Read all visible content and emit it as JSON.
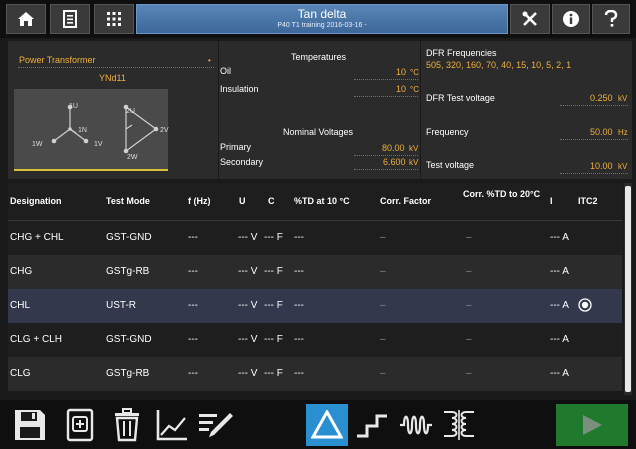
{
  "header": {
    "title": "Tan delta",
    "subtitle": "P40 T1 training 2016-03-16 -"
  },
  "asset": {
    "type": "Power Transformer",
    "vector_group": "YNd11",
    "hv_winding": "YN",
    "lv_winding": "d11",
    "diagram_labels": {
      "u1": "1U",
      "v1": "1V",
      "w1": "1W",
      "n1": "1N",
      "u2": "2U",
      "v2": "2V",
      "w2": "2W"
    }
  },
  "temperatures": {
    "heading": "Temperatures",
    "oil_label": "Oil",
    "oil_value": "10",
    "oil_unit": "°C",
    "insulation_label": "Insulation",
    "insulation_value": "10",
    "insulation_unit": "°C"
  },
  "nominal_voltages": {
    "heading": "Nominal Voltages",
    "primary_label": "Primary",
    "primary_value": "80.00",
    "primary_unit": "kV",
    "secondary_label": "Secondary",
    "secondary_value": "6.600",
    "secondary_unit": "kV"
  },
  "dfr": {
    "freq_heading": "DFR Frequencies",
    "freq_list": "505, 320, 160, 70, 40, 15, 10, 5, 2, 1",
    "test_voltage_label": "DFR Test voltage",
    "test_voltage_value": "0.250",
    "test_voltage_unit": "kV"
  },
  "frequency": {
    "label": "Frequency",
    "value": "50.00",
    "unit": "Hz"
  },
  "test_voltage": {
    "label": "Test voltage",
    "value": "10.00",
    "unit": "kV"
  },
  "table": {
    "headers": {
      "designation": "Designation",
      "test_mode": "Test Mode",
      "f": "f (Hz)",
      "u": "U",
      "c": "C",
      "td10": "%TD at 10 °C",
      "corr": "Corr. Factor",
      "corrtd": "Corr. %TD to 20°C",
      "i": "I",
      "itc2": "ITC2"
    },
    "rows": [
      {
        "designation": "CHG + CHL",
        "mode": "GST-GND",
        "f": "---",
        "u": "--- V",
        "c": "--- F",
        "td": "---",
        "corr": "–",
        "corrtd": "–",
        "i": "--- A"
      },
      {
        "designation": "CHG",
        "mode": "GSTg-RB",
        "f": "---",
        "u": "--- V",
        "c": "--- F",
        "td": "---",
        "corr": "–",
        "corrtd": "–",
        "i": "--- A"
      },
      {
        "designation": "CHL",
        "mode": "UST-R",
        "f": "---",
        "u": "--- V",
        "c": "--- F",
        "td": "---",
        "corr": "–",
        "corrtd": "–",
        "i": "--- A"
      },
      {
        "designation": "CLG + CLH",
        "mode": "GST-GND",
        "f": "---",
        "u": "--- V",
        "c": "--- F",
        "td": "---",
        "corr": "–",
        "corrtd": "–",
        "i": "--- A"
      },
      {
        "designation": "CLG",
        "mode": "GSTg-RB",
        "f": "---",
        "u": "--- V",
        "c": "--- F",
        "td": "---",
        "corr": "–",
        "corrtd": "–",
        "i": "--- A"
      }
    ]
  },
  "colors": {
    "accent_orange": "#f0b03c",
    "title_blue": "#4a78ad",
    "selected_row": "#33384d",
    "active_tool": "#2a8fd0",
    "play_green": "#1f7a2e"
  }
}
